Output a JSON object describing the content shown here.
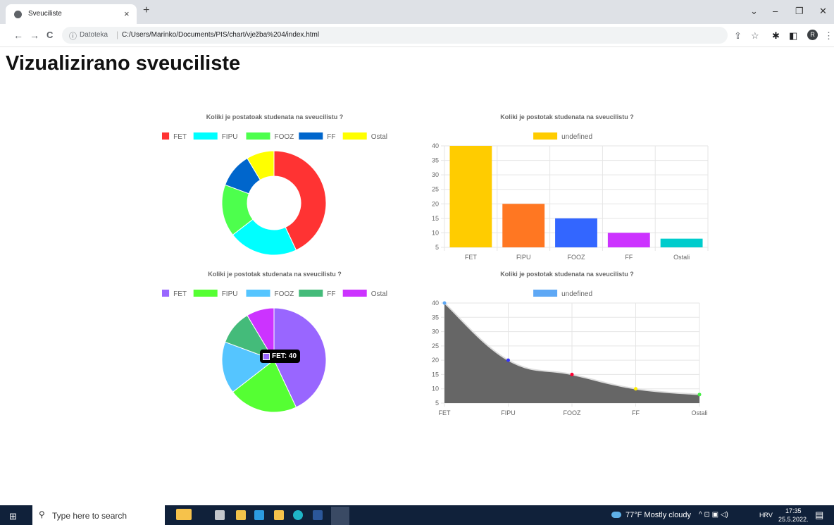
{
  "browser": {
    "tab_title": "Sveuciliste",
    "tab_close": "×",
    "new_tab": "+",
    "window_controls": [
      "⌄",
      "–",
      "❐",
      "✕"
    ],
    "nav": {
      "back": "←",
      "forward": "→",
      "reload": "C"
    },
    "address": {
      "info_icon": "ⓘ",
      "label": "Datoteka",
      "url": "C:/Users/Marinko/Documents/PIS/chart/vježba%204/index.html"
    },
    "right_icons": [
      "share-icon",
      "star-icon",
      "extensions-icon",
      "sidebar-icon",
      "profile-icon",
      "menu-icon"
    ],
    "right_glyphs": [
      "⇪",
      "☆",
      "✱",
      "◧",
      "⋮"
    ],
    "profile_initial": "R"
  },
  "page": {
    "heading": "Vizualizirano sveuciliste"
  },
  "chart_data": [
    {
      "type": "pie",
      "variant": "doughnut",
      "title": "Koliki je postatoak studenata na sveucilistu ?",
      "categories": [
        "FET",
        "FIPU",
        "FOOZ",
        "FF",
        "Ostali"
      ],
      "values": [
        40,
        20,
        15,
        10,
        8
      ],
      "colors": [
        "#ff3333",
        "#00ffff",
        "#4dff4d",
        "#0066cc",
        "#ffff00"
      ],
      "legend": "top"
    },
    {
      "type": "bar",
      "title": "Koliki je postotak studenata na sveucilistu ?",
      "legend_label": "undefined",
      "legend_color": "#ffcc00",
      "categories": [
        "FET",
        "FIPU",
        "FOOZ",
        "FF",
        "Ostali"
      ],
      "values": [
        40,
        20,
        15,
        10,
        8
      ],
      "colors": [
        "#ffcc00",
        "#ff7722",
        "#3366ff",
        "#cc33ff",
        "#00cccc"
      ],
      "ylim": [
        5,
        40
      ],
      "yticks": [
        40,
        35,
        30,
        25,
        20,
        15,
        10,
        5
      ],
      "grid": true
    },
    {
      "type": "pie",
      "title": "Koliki je postotak studenata na sveucilistu ?",
      "categories": [
        "FET",
        "FIPU",
        "FOOZ",
        "FF",
        "Ostali"
      ],
      "values": [
        40,
        20,
        15,
        10,
        8
      ],
      "colors": [
        "#9966ff",
        "#55ff33",
        "#55c5ff",
        "#44bb7a",
        "#cc33ff"
      ],
      "legend": "top",
      "tooltip": "FET: 40"
    },
    {
      "type": "area",
      "title": "Koliki je postotak studenata na sveucilistu ?",
      "legend_label": "undefined",
      "legend_color": "#5ea8f5",
      "fill_color": "#666666",
      "categories": [
        "FET",
        "FIPU",
        "FOOZ",
        "FF",
        "Ostali"
      ],
      "values": [
        40,
        20,
        15,
        10,
        8
      ],
      "point_colors": [
        "#5ea8f5",
        "#3333ff",
        "#ff0033",
        "#ffee00",
        "#44ee44"
      ],
      "ylim": [
        5,
        40
      ],
      "yticks": [
        40,
        35,
        30,
        25,
        20,
        15,
        10,
        5
      ],
      "grid": true
    }
  ],
  "taskbar": {
    "search_placeholder": "Type here to search",
    "weather": "77°F  Mostly cloudy",
    "tray_glyphs": "^  ⊡  ▣  ◁)  ",
    "language": "HRV",
    "time": "17:35",
    "date": "25.5.2022.",
    "notification_count": "5"
  }
}
